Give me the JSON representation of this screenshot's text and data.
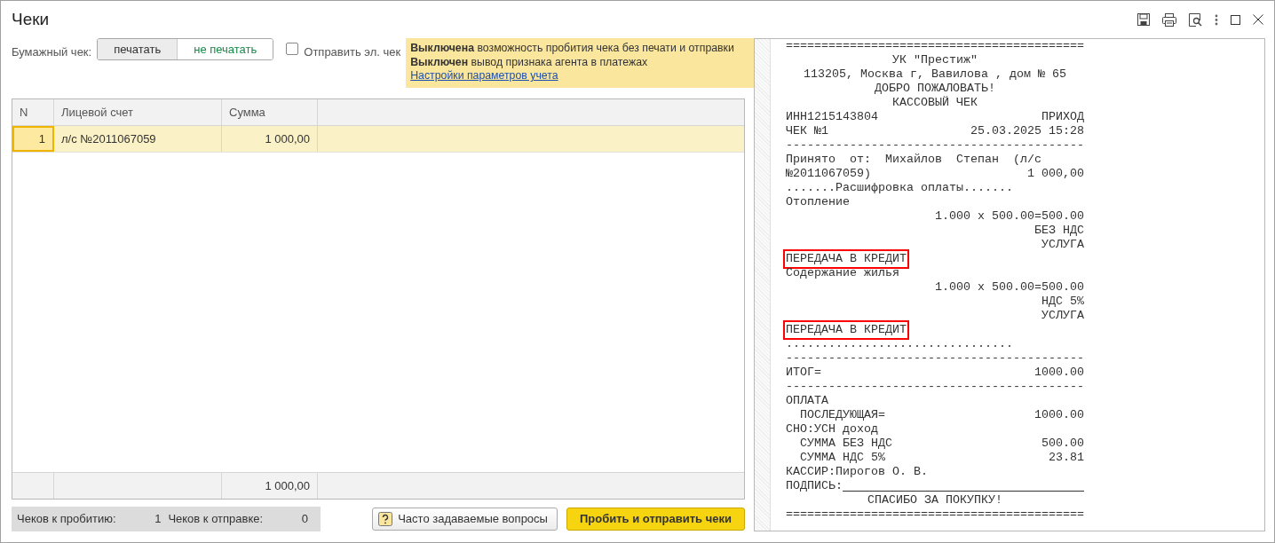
{
  "window": {
    "title": "Чеки"
  },
  "paper_check": {
    "label": "Бумажный чек:",
    "options": [
      {
        "label": "печатать",
        "selected": true
      },
      {
        "label": "не печатать",
        "selected": false
      }
    ]
  },
  "send_email": {
    "label": "Отправить эл. чек",
    "checked": false
  },
  "notice": {
    "lines": [
      "**Выключена** возможность пробития чека без печати и отправки",
      "**Выключен** вывод признака агента в платежах"
    ],
    "link": "Настройки параметров учета"
  },
  "table": {
    "columns": [
      "N",
      "Лицевой счет",
      "Сумма"
    ],
    "rows": [
      {
        "n": "1",
        "account": "л/с №2011067059",
        "sum": "1 000,00",
        "selected": true
      }
    ],
    "total": "1 000,00"
  },
  "counters": [
    {
      "label": "Чеков к пробитию:",
      "value": "1"
    },
    {
      "label": "Чеков к отправке:",
      "value": "0"
    }
  ],
  "buttons": [
    {
      "kind": "help",
      "label": "Часто задаваемые вопросы"
    },
    {
      "kind": "primary",
      "label": "Пробить и отправить чеки"
    }
  ],
  "receipt": [
    {
      "kind": "rule",
      "text": "==========================================",
      "highlighted": false
    },
    {
      "kind": "center",
      "text": "УК \"Престиж\"",
      "highlighted": false
    },
    {
      "kind": "center",
      "text": "113205, Москва г, Вавилова , дом № 65",
      "highlighted": false
    },
    {
      "kind": "center",
      "text": "ДОБРО ПОЖАЛОВАТЬ!",
      "highlighted": false
    },
    {
      "kind": "center",
      "text": "КАССОВЫЙ ЧЕК",
      "highlighted": false
    },
    {
      "kind": "pair",
      "text": "ИНН1215143804",
      "value": "ПРИХОД",
      "highlighted": false
    },
    {
      "kind": "pair",
      "text": "ЧЕК №1",
      "value": "25.03.2025 15:28",
      "highlighted": false
    },
    {
      "kind": "rule",
      "text": "------------------------------------------",
      "highlighted": false
    },
    {
      "kind": "left",
      "text": "Принято  от:  Михайлов  Степан  (л/с",
      "highlighted": false
    },
    {
      "kind": "pair",
      "text": "№2011067059)",
      "value": "1 000,00",
      "highlighted": false
    },
    {
      "kind": "left",
      "text": ".......Расшифровка оплаты.......",
      "highlighted": false
    },
    {
      "kind": "left",
      "text": "Отопление",
      "highlighted": false
    },
    {
      "kind": "right",
      "text": "1.000 x 500.00=500.00",
      "highlighted": false
    },
    {
      "kind": "right",
      "text": "БЕЗ НДС",
      "highlighted": false
    },
    {
      "kind": "right",
      "text": "УСЛУГА",
      "highlighted": false
    },
    {
      "kind": "left",
      "text": "ПЕРЕДАЧА В КРЕДИТ",
      "highlighted": true
    },
    {
      "kind": "left",
      "text": "Содержание жилья",
      "highlighted": false
    },
    {
      "kind": "right",
      "text": "1.000 x 500.00=500.00",
      "highlighted": false
    },
    {
      "kind": "right",
      "text": "НДС 5%",
      "highlighted": false
    },
    {
      "kind": "right",
      "text": "УСЛУГА",
      "highlighted": false
    },
    {
      "kind": "left",
      "text": "ПЕРЕДАЧА В КРЕДИТ",
      "highlighted": true
    },
    {
      "kind": "left",
      "text": "................................",
      "highlighted": false
    },
    {
      "kind": "rule",
      "text": "------------------------------------------",
      "highlighted": false
    },
    {
      "kind": "pair",
      "text": "ИТОГ=",
      "value": "1000.00",
      "highlighted": false
    },
    {
      "kind": "rule",
      "text": "------------------------------------------",
      "highlighted": false
    },
    {
      "kind": "left",
      "text": "ОПЛАТА",
      "highlighted": false
    },
    {
      "kind": "pair",
      "text": "  ПОСЛЕДУЮЩАЯ=",
      "value": "1000.00",
      "highlighted": false
    },
    {
      "kind": "left",
      "text": "СНО:УСН доход",
      "highlighted": false
    },
    {
      "kind": "pair",
      "text": "  СУММА БЕЗ НДС",
      "value": "500.00",
      "highlighted": false
    },
    {
      "kind": "pair",
      "text": "  СУММА НДС 5%",
      "value": "23.81",
      "highlighted": false
    },
    {
      "kind": "left",
      "text": "КАССИР:Пирогов О. В.",
      "highlighted": false
    },
    {
      "kind": "signature",
      "text": "ПОДПИСЬ:",
      "highlighted": false
    },
    {
      "kind": "center",
      "text": "СПАСИБО ЗА ПОКУПКУ!",
      "highlighted": false
    },
    {
      "kind": "rule",
      "text": "==========================================",
      "highlighted": false
    }
  ]
}
